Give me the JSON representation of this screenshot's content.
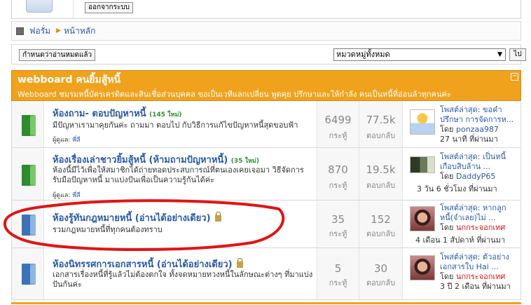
{
  "user_panel": {
    "logout_label": "ออกจากระบบ"
  },
  "breadcrumb": {
    "items": [
      "ฟอรั่ม",
      "หน้าหลัก"
    ]
  },
  "toolbar": {
    "mark_read_label": "กำหนดว่าอ่านหมดแล้ว",
    "category_select_value": "หมวดหมู่ทั้งหมด",
    "go_label": "ไป"
  },
  "category": {
    "title": "webboard คนยิ้มสู้หนี้",
    "description": "Webboard ชมรมหนี้บัตรเครดิตและสินเชื่อส่วนบุคคล ขอเป็นเวทีแลกเปลี่ยน พูดคุย ปรึกษาและให้กำลัง คนเป็นหนี้ที่อ่อนล้าทุกคนค่ะ"
  },
  "labels": {
    "topics": "กระทู้",
    "replies": "ตอบกลับ",
    "mods_prefix": "ผู้ดูแล:"
  },
  "forums": [
    {
      "title": "ห้องถาม- ตอบปัญหาหนี้",
      "new_count": "(145 ใหม่)",
      "description": "มีปัญหาเรามาคุยกันค่ะ ถามมา ตอบไป กับวิธีการแก้ไขปัญหาหนี้สุดขอบฟ้า",
      "moderator": "พี่ลี",
      "topics": "6499",
      "replies": "77.5k",
      "last_line1": "โพสต์ล่าสุด: ขอคำปรึกษา การจัดการห...",
      "last_by_prefix": "โดย ",
      "last_by": "ponzaa987",
      "last_time": "27 นาที ที่ผ่านมา"
    },
    {
      "title": "ห้องเรื่องเล่าชาวยิ้มสู้หนี้ (ห้ามถามปัญหาหนี้)",
      "new_count": "(35 ใหม่)",
      "description": "ห้องนี้มีไว้เพื่อให้สมาชิกได้ถ่ายทอดประสบการณ์ที่ตนเองเคยเจอมา วิธีจัดการ รับมือปัญหาหนี้ มาแบ่งปันเพื่อเป็นความรู้กันได้ค่ะ",
      "moderator": "พี่ลี",
      "topics": "870",
      "replies": "19.5k",
      "last_line1": "โพสต์ล่าสุด: เป็นหนี้เกือบสิบล้าน ...",
      "last_by_prefix": "โดย ",
      "last_by": "DaddyP65",
      "last_time": "3 วัน 6 ชั่วโมง ที่ผ่านมา"
    },
    {
      "title": "ห้องรู้ทันกฎหมายหนี้ (อ่านได้อย่างเดียว)",
      "description": "รวมกฎหมายหนี้ที่ทุกคนต้องทราบ",
      "topics": "35",
      "replies": "152",
      "last_line1": "โพสต์ล่าสุด: หากลูกหนี้(จำเลย)ไม่ ...",
      "last_by_prefix": "โดย ",
      "last_by": "นกกระจอกเทศ",
      "last_time": "4 เดือน 1 สัปดาห์ ที่ผ่านมา"
    },
    {
      "title": "ห้องนิทรรศการเอกสารหนี้ (อ่านได้อย่างเดียว)",
      "description": "เอกสารเรื่องหนี้ที่รู้แล้วไม่ต้องตกใจ ทั้งจดหมายทวงหนี้ในลักษณะต่างๆ ที่มาแบ่งปันกันค่ะ",
      "topics": "5",
      "replies": "30",
      "last_line1": "โพสต์ล่าสุด: ตัวอย่างเอกสารใบ Hai ...",
      "last_by_prefix": "โดย ",
      "last_by": "นกกระจอกเทศ",
      "last_time": "3 ปี 2 เดือน ที่ผ่านมา"
    }
  ],
  "colors": {
    "accent": "#f0a21c",
    "link": "#2a5aa8",
    "annotation": "#e01515"
  }
}
